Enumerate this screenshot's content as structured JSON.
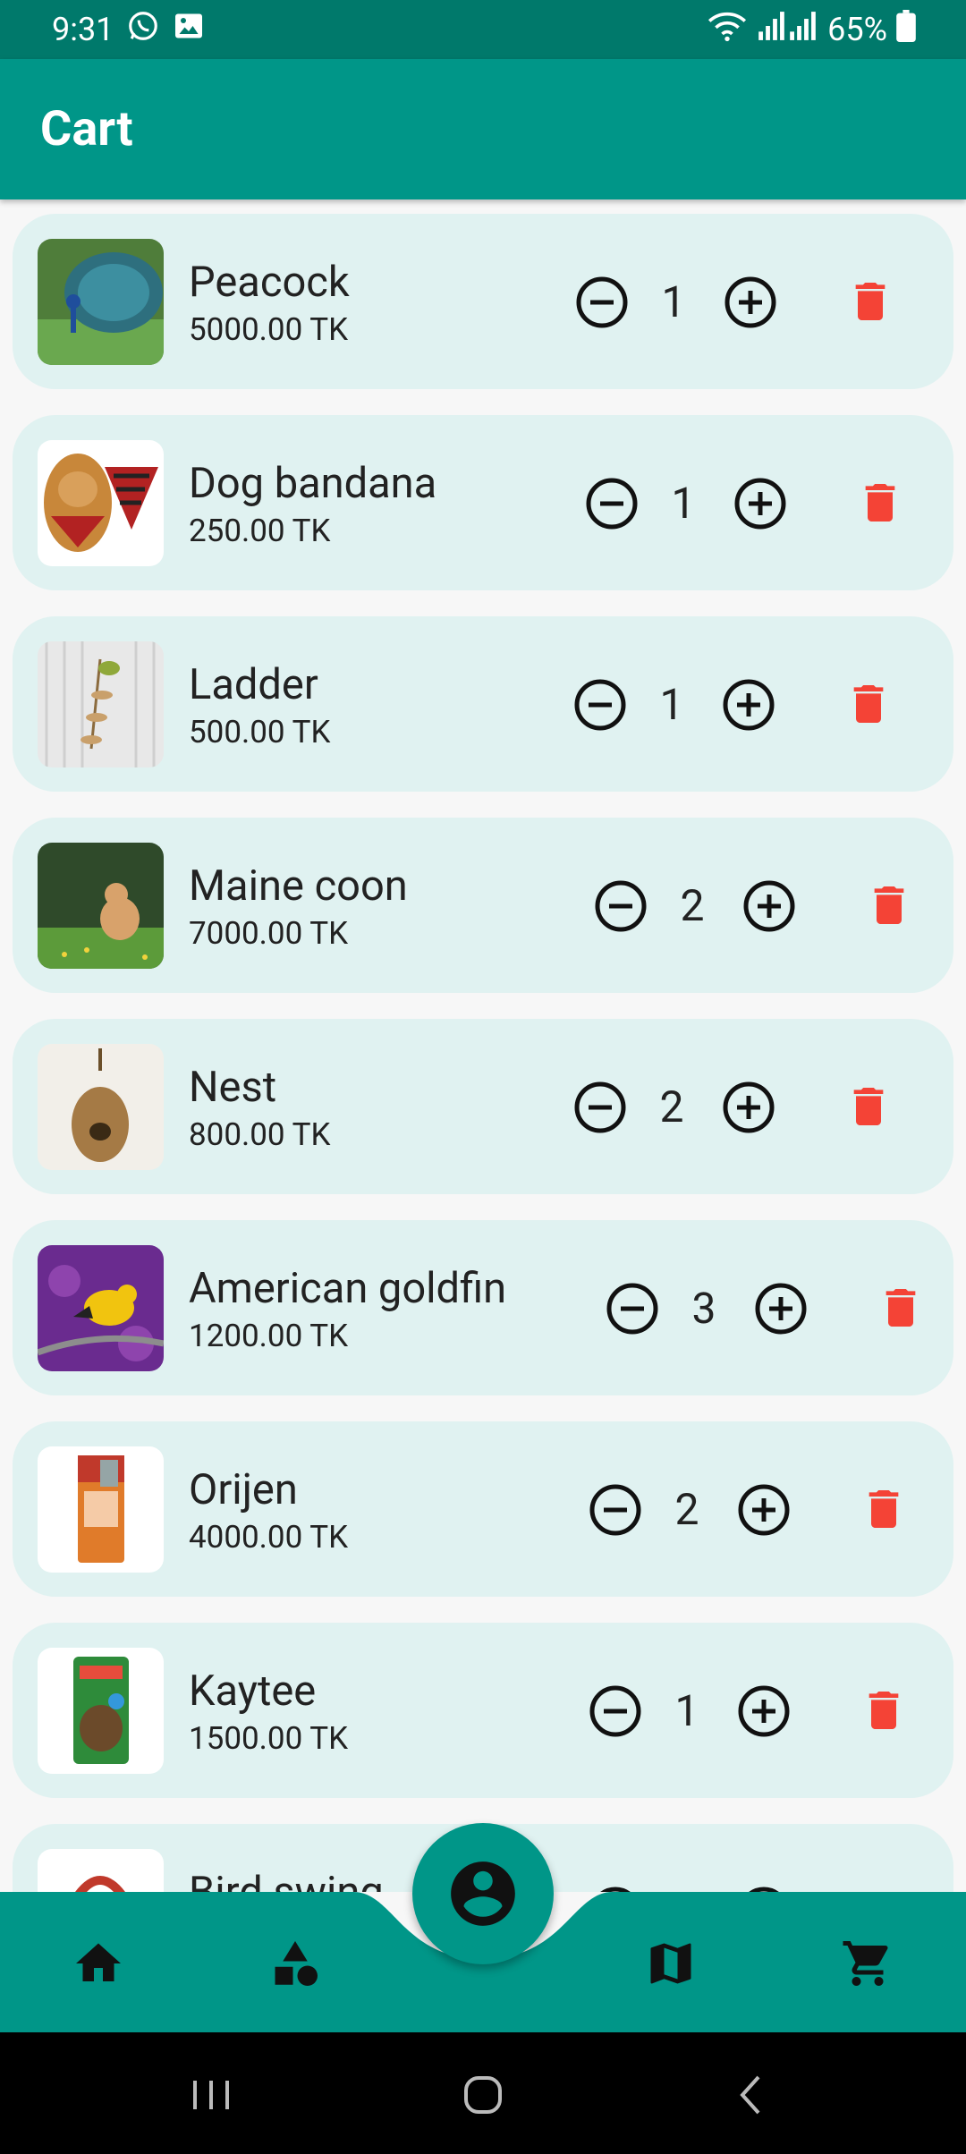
{
  "status_bar": {
    "time": "9:31",
    "battery": "65%",
    "icons": [
      "whatsapp-icon",
      "gallery-icon",
      "wifi-icon",
      "signal-icon",
      "battery-icon"
    ]
  },
  "app_bar": {
    "title": "Cart"
  },
  "colors": {
    "primary": "#009688",
    "primary_dark": "#00796b",
    "card_bg": "#e0f2f1",
    "delete": "#f44336",
    "text": "#222222"
  },
  "cart": {
    "items": [
      {
        "name": "Peacock",
        "price": "5000.00 TK",
        "quantity": "1"
      },
      {
        "name": "Dog bandana",
        "price": "250.00 TK",
        "quantity": "1"
      },
      {
        "name": "Ladder",
        "price": "500.00 TK",
        "quantity": "1"
      },
      {
        "name": "Maine coon",
        "price": "7000.00 TK",
        "quantity": "2"
      },
      {
        "name": "Nest",
        "price": "800.00 TK",
        "quantity": "2"
      },
      {
        "name": "American goldfin",
        "price": "1200.00 TK",
        "quantity": "3"
      },
      {
        "name": "Orijen",
        "price": "4000.00 TK",
        "quantity": "2"
      },
      {
        "name": "Kaytee",
        "price": "1500.00 TK",
        "quantity": "1"
      },
      {
        "name": "Bird swing"
      }
    ]
  },
  "bottom_nav": {
    "items": [
      "home-icon",
      "categories-icon",
      "map-icon",
      "cart-icon"
    ],
    "fab": "profile-icon"
  },
  "system_nav": [
    "recents-icon",
    "home-circle-icon",
    "back-icon"
  ]
}
